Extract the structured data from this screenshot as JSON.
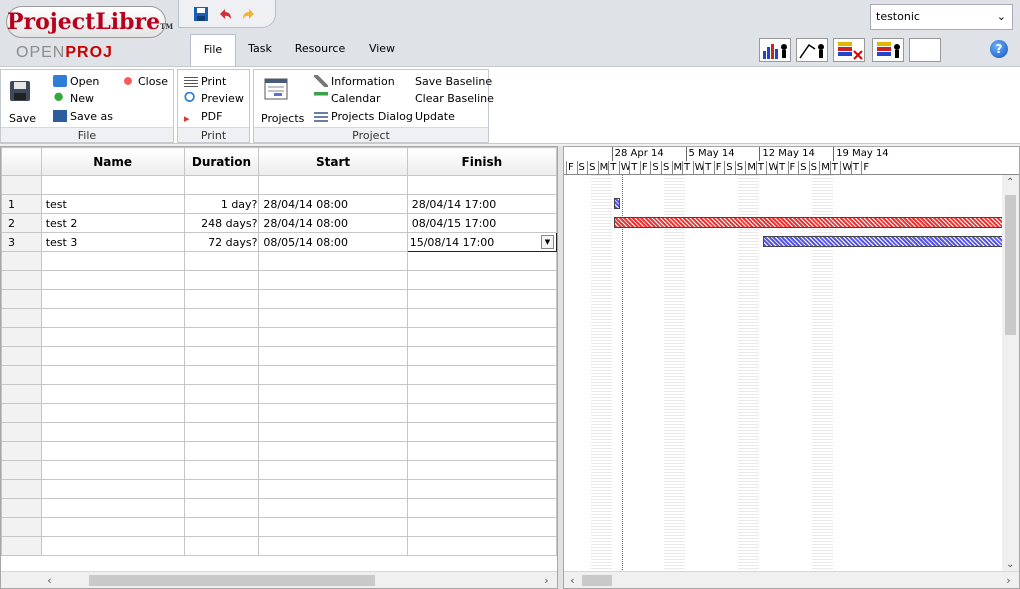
{
  "app": {
    "logo_main": "ProjectLibre",
    "logo_tm": "TM",
    "logo_sub_a": "OPEN",
    "logo_sub_b": "PROJ",
    "user": "testonic"
  },
  "tabs": [
    "File",
    "Task",
    "Resource",
    "View"
  ],
  "ribbon": {
    "file_group": {
      "label": "File",
      "save": "Save",
      "open": "Open",
      "close": "Close",
      "new": "New",
      "save_as": "Save as"
    },
    "print_group": {
      "label": "Print",
      "print": "Print",
      "preview": "Preview",
      "pdf": "PDF"
    },
    "project_group": {
      "label": "Project",
      "projects": "Projects",
      "information": "Information",
      "calendar": "Calendar",
      "projects_dialog": "Projects Dialog",
      "save_baseline": "Save Baseline",
      "clear_baseline": "Clear Baseline",
      "update": "Update"
    }
  },
  "table": {
    "columns": [
      "",
      "Name",
      "Duration",
      "Start",
      "Finish"
    ],
    "rows": [
      {
        "num": "",
        "name": "",
        "duration": "",
        "start": "",
        "finish": ""
      },
      {
        "num": "1",
        "name": "test",
        "duration": "1 day?",
        "start": "28/04/14 08:00",
        "finish": "28/04/14 17:00"
      },
      {
        "num": "2",
        "name": "test 2",
        "duration": "248 days?",
        "start": "28/04/14 08:00",
        "finish": "08/04/15 17:00"
      },
      {
        "num": "3",
        "name": "test 3",
        "duration": "72 days?",
        "start": "08/05/14 08:00",
        "finish": "15/08/14 17:00"
      }
    ]
  },
  "gantt": {
    "weeks": [
      "28 Apr 14",
      "5 May 14",
      "12 May 14",
      "19 May 14"
    ],
    "days": [
      "F",
      "S",
      "S",
      "M",
      "T",
      "W",
      "T",
      "F",
      "S",
      "S",
      "M",
      "T",
      "W",
      "T",
      "F",
      "S",
      "S",
      "M",
      "T",
      "W",
      "T",
      "F",
      "S",
      "S",
      "M",
      "T",
      "W",
      "T",
      "F"
    ],
    "colors": {
      "task_bar": "#5555ee",
      "critical_bar": "#ee3333"
    }
  }
}
